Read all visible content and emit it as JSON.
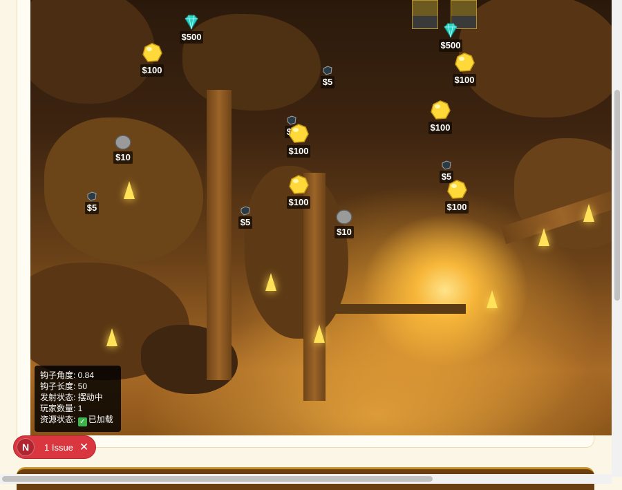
{
  "game": {
    "items": [
      {
        "kind": "diamond",
        "label": "$500"
      },
      {
        "kind": "gold",
        "label": "$100"
      },
      {
        "kind": "diamond",
        "label": "$500"
      },
      {
        "kind": "gold",
        "label": "$100"
      },
      {
        "kind": "coal",
        "label": "$5"
      },
      {
        "kind": "gold",
        "label": "$100"
      },
      {
        "kind": "stone",
        "label": "$10"
      },
      {
        "kind": "coal",
        "label": "$5"
      },
      {
        "kind": "gold",
        "label": "$100"
      },
      {
        "kind": "coal",
        "label": "$5"
      },
      {
        "kind": "gold",
        "label": "$100"
      },
      {
        "kind": "coal",
        "label": "$5"
      },
      {
        "kind": "gold",
        "label": "$100"
      },
      {
        "kind": "coal",
        "label": "$5"
      },
      {
        "kind": "stone",
        "label": "$10"
      }
    ],
    "colors": {
      "gold": "#ffd93a",
      "diamond": "#2ad1c4",
      "stone": "#9a9a9a",
      "coal": "#2c3a44"
    }
  },
  "hud": {
    "hook_angle": "钩子角度: 0.84",
    "hook_length": "钩子长度: 50",
    "launch_state": "发射状态: 摆动中",
    "player_count": "玩家数量: 1",
    "resource_state": "资源状态:",
    "resource_value": "已加载"
  },
  "issue_badge": {
    "avatar": "N",
    "text": "1 Issue",
    "close": "✕"
  }
}
